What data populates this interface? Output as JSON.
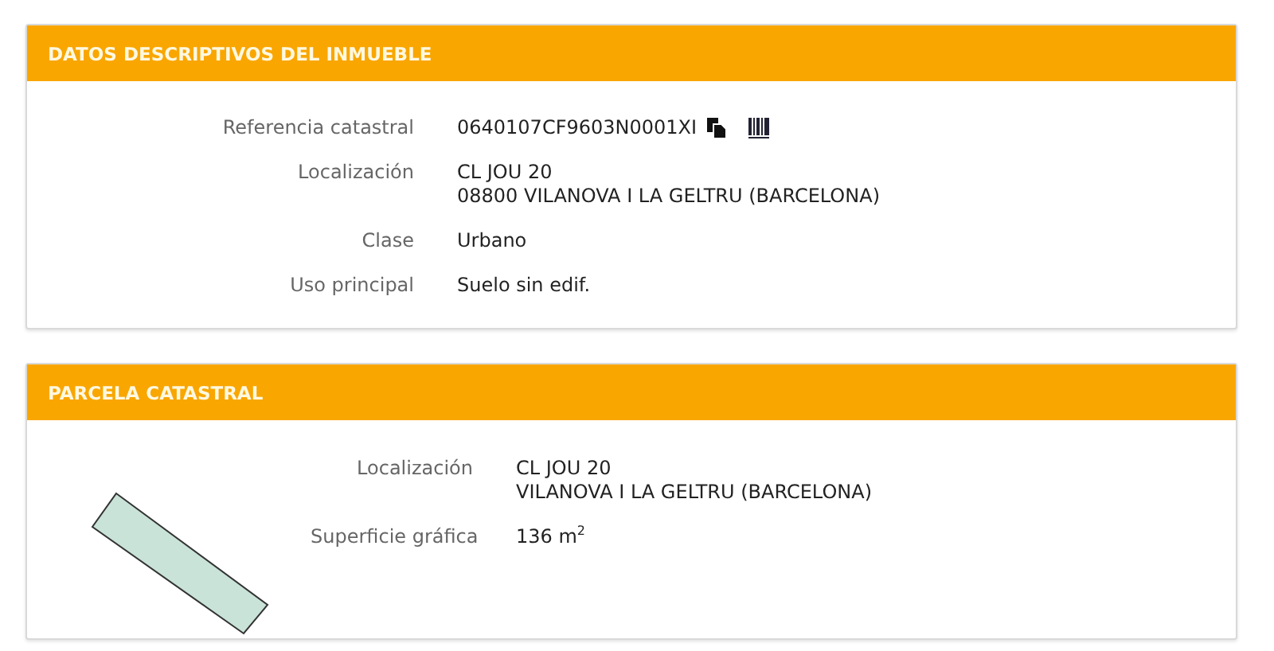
{
  "panels": [
    {
      "title": "DATOS DESCRIPTIVOS DEL INMUEBLE",
      "kind": "fields",
      "rows": [
        {
          "kind": "reference",
          "label": "Referencia catastral",
          "lines": [
            "0640107CF9603N0001XI"
          ]
        },
        {
          "kind": "text",
          "label": "Localización",
          "lines": [
            "CL JOU 20",
            "08800 VILANOVA I LA GELTRU (BARCELONA)"
          ]
        },
        {
          "kind": "text",
          "label": "Clase",
          "lines": [
            "Urbano"
          ]
        },
        {
          "kind": "text",
          "label": "Uso principal",
          "lines": [
            "Suelo sin edif."
          ]
        }
      ]
    },
    {
      "title": "PARCELA CATASTRAL",
      "kind": "parcel",
      "rows": [
        {
          "kind": "text",
          "label": "Localización",
          "lines": [
            "CL JOU 20",
            "VILANOVA I LA GELTRU (BARCELONA)"
          ]
        },
        {
          "kind": "text",
          "label": "Superficie gráfica",
          "lines": [
            "136 m$^{2}$"
          ]
        }
      ]
    }
  ]
}
